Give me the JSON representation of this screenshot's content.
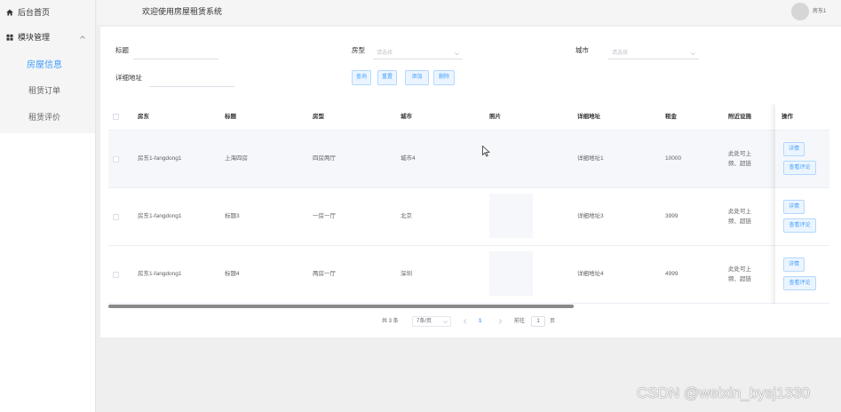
{
  "colors": {
    "primary": "#409eff",
    "row_hover": "#f5f7fa"
  },
  "header": {
    "title": "欢迎使用房屋租赁系统",
    "username": "房东1"
  },
  "sidebar": {
    "home": {
      "label": "后台首页",
      "icon": "home-icon"
    },
    "module": {
      "label": "模块管理",
      "icon": "grid-icon",
      "expanded": true
    },
    "submenu": [
      {
        "label": "房屋信息",
        "active": true
      },
      {
        "label": "租赁订单",
        "active": false
      },
      {
        "label": "租赁评价",
        "active": false
      }
    ]
  },
  "search": {
    "title_label": "标题",
    "house_type_label": "房型",
    "house_type_placeholder": "请选择",
    "city_label": "城市",
    "city_placeholder": "请选择",
    "address_label": "详细地址",
    "buttons": {
      "query": "查询",
      "reset": "重置",
      "add": "添加",
      "delete": "删除"
    }
  },
  "table": {
    "columns": {
      "landlord": "房东",
      "title": "标题",
      "house_type": "房型",
      "city": "城市",
      "photo": "照片",
      "address": "详细地址",
      "rent": "租金",
      "facilities": "附近设施",
      "actions": "操作"
    },
    "rows": [
      {
        "landlord": "房东1-fangdong1",
        "title": "上海四房",
        "house_type": "四房两厅",
        "city": "城市4",
        "address": "详细地址1",
        "rent": "10000",
        "facilities": [
          "此处可上",
          "频、超链"
        ],
        "highlighted": true
      },
      {
        "landlord": "房东1-fangdong1",
        "title": "标题3",
        "house_type": "一房一厅",
        "city": "北京",
        "address": "详细地址3",
        "rent": "3999",
        "facilities": [
          "此处可上",
          "频、超链"
        ],
        "highlighted": false
      },
      {
        "landlord": "房东1-fangdong1",
        "title": "标题4",
        "house_type": "两房一厅",
        "city": "深圳",
        "address": "详细地址4",
        "rent": "4999",
        "facilities": [
          "此处可上",
          "频、超链"
        ],
        "highlighted": false
      }
    ],
    "row_actions": {
      "detail": "详情",
      "comments": "查看评论"
    }
  },
  "pagination": {
    "total": "共 3 条",
    "page_size": "7条/页",
    "current_page": "1",
    "goto_label": "前往",
    "goto_value": "1",
    "page_unit": "页"
  },
  "watermark": "CSDN @weixin_bysj1330"
}
